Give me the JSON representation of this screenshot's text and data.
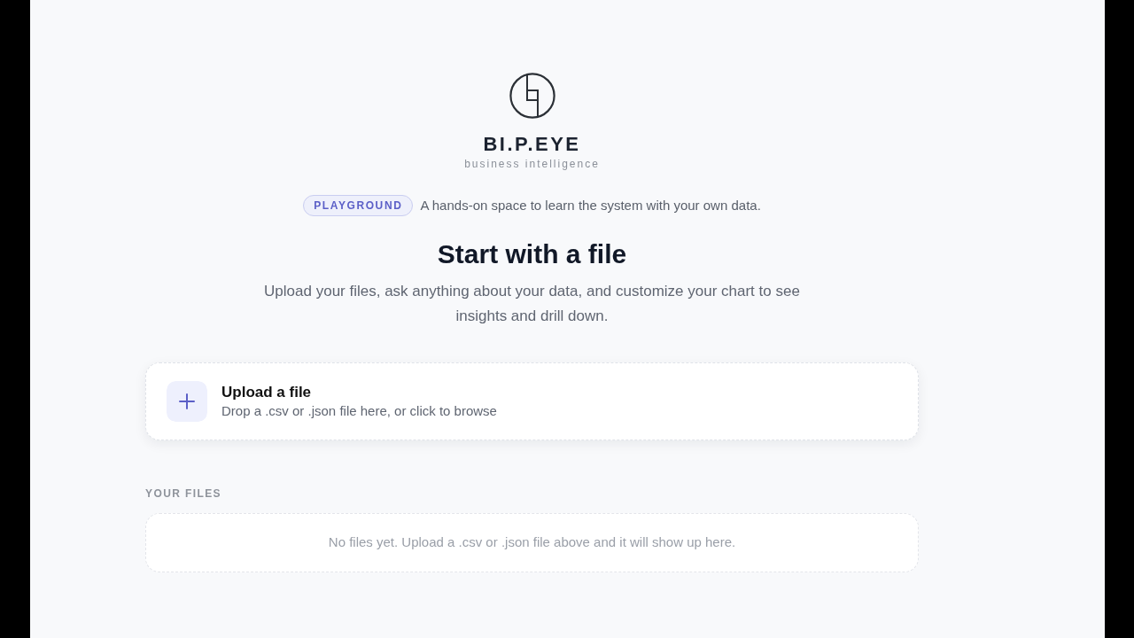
{
  "brand": {
    "name": "BI.P.EYE",
    "tagline": "business intelligence"
  },
  "intro": {
    "badge": "PLAYGROUND",
    "text": "A hands-on space to learn the system with your own data."
  },
  "heading": "Start with a file",
  "subtitle": "Upload your files, ask anything about your data, and customize your chart to see insights and drill down.",
  "upload": {
    "title": "Upload a file",
    "hint": "Drop a .csv or .json file here, or click to browse"
  },
  "files": {
    "label": "YOUR FILES",
    "empty_message": "No files yet. Upload a .csv or .json file above and it will show up here."
  }
}
